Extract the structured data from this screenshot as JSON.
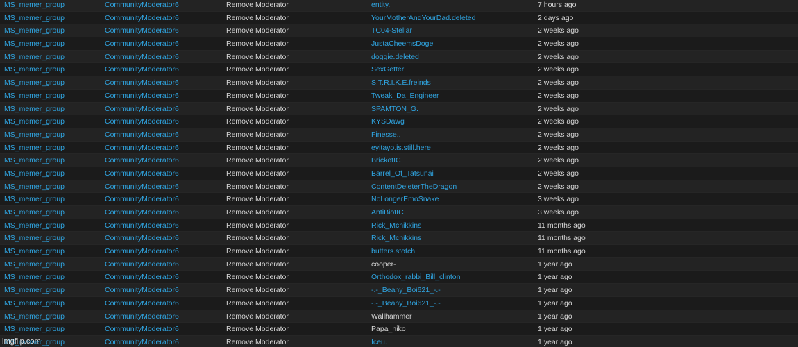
{
  "columns_fixed": {
    "group": "MS_memer_group",
    "moderator": "CommunityModerator6",
    "action": "Remove Moderator"
  },
  "rows": [
    {
      "target": "entity.",
      "target_link": true,
      "time": "7 hours ago"
    },
    {
      "target": "YourMotherAndYourDad.deleted",
      "target_link": true,
      "time": "2 days ago"
    },
    {
      "target": "TC04-Stellar",
      "target_link": true,
      "time": "2 weeks ago"
    },
    {
      "target": "JustaCheemsDoge",
      "target_link": true,
      "time": "2 weeks ago"
    },
    {
      "target": "doggie.deleted",
      "target_link": true,
      "time": "2 weeks ago"
    },
    {
      "target": "SexGetter",
      "target_link": true,
      "time": "2 weeks ago"
    },
    {
      "target": "S.T.R.I.K.E.freinds",
      "target_link": true,
      "time": "2 weeks ago"
    },
    {
      "target": "Tweak_Da_Engineer",
      "target_link": true,
      "time": "2 weeks ago"
    },
    {
      "target": "SPAMTON_G.",
      "target_link": true,
      "time": "2 weeks ago"
    },
    {
      "target": "KYSDawg",
      "target_link": true,
      "time": "2 weeks ago"
    },
    {
      "target": "Finesse..",
      "target_link": true,
      "time": "2 weeks ago"
    },
    {
      "target": "eyitayo.is.still.here",
      "target_link": true,
      "time": "2 weeks ago"
    },
    {
      "target": "BrickotIC",
      "target_link": true,
      "time": "2 weeks ago"
    },
    {
      "target": "Barrel_Of_Tatsunai",
      "target_link": true,
      "time": "2 weeks ago"
    },
    {
      "target": "ContentDeleterTheDragon",
      "target_link": true,
      "time": "2 weeks ago"
    },
    {
      "target": "NoLongerEmoSnake",
      "target_link": true,
      "time": "3 weeks ago"
    },
    {
      "target": "AntiBiotIC",
      "target_link": true,
      "time": "3 weeks ago"
    },
    {
      "target": "Rick_Mcnikkins",
      "target_link": true,
      "time": "11 months ago"
    },
    {
      "target": "Rick_Mcnikkins",
      "target_link": true,
      "time": "11 months ago"
    },
    {
      "target": "butters.stotch",
      "target_link": true,
      "time": "11 months ago"
    },
    {
      "target": "cooper-",
      "target_link": false,
      "time": "1 year ago"
    },
    {
      "target": "Orthodox_rabbi_Bill_clinton",
      "target_link": true,
      "time": "1 year ago"
    },
    {
      "target": "-.-_Beany_Boi621_-.-",
      "target_link": true,
      "time": "1 year ago"
    },
    {
      "target": "-.-_Beany_Boi621_-.-",
      "target_link": true,
      "time": "1 year ago"
    },
    {
      "target": "Wallhammer",
      "target_link": false,
      "time": "1 year ago"
    },
    {
      "target": "Papa_niko",
      "target_link": false,
      "time": "1 year ago"
    },
    {
      "target": "Iceu.",
      "target_link": true,
      "time": "1 year ago"
    }
  ],
  "watermark": "imgflip.com",
  "colors": {
    "link": "#2fa4e0",
    "text": "#d6d6d6",
    "row_odd": "#232323",
    "row_even": "#1b1b1b"
  }
}
